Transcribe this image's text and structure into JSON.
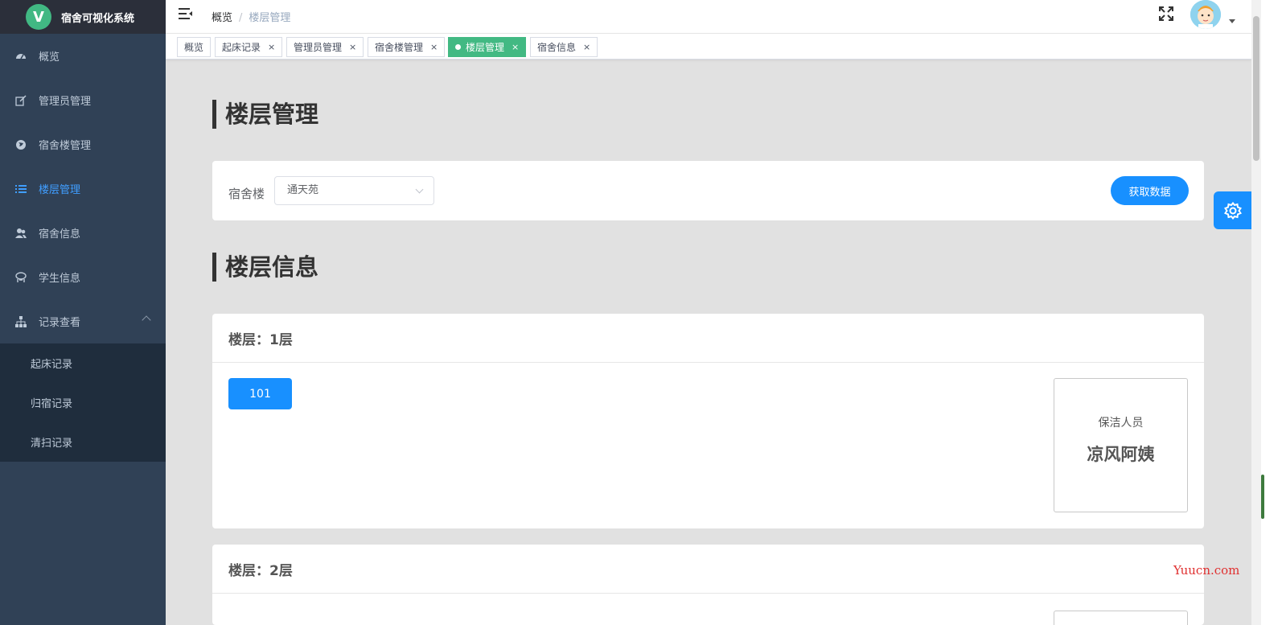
{
  "app": {
    "logo_letter": "V",
    "title": "宿舍可视化系统"
  },
  "sidebar": {
    "items": [
      {
        "label": "概览",
        "icon": "dashboard-icon"
      },
      {
        "label": "管理员管理",
        "icon": "edit-icon"
      },
      {
        "label": "宿舍楼管理",
        "icon": "globe-icon"
      },
      {
        "label": "楼层管理",
        "icon": "list-icon",
        "active": true
      },
      {
        "label": "宿舍信息",
        "icon": "users-icon"
      },
      {
        "label": "学生信息",
        "icon": "student-icon"
      },
      {
        "label": "记录查看",
        "icon": "sitemap-icon"
      }
    ],
    "submenu": [
      "起床记录",
      "归宿记录",
      "清扫记录"
    ]
  },
  "header": {
    "breadcrumb": [
      "概览",
      "楼层管理"
    ]
  },
  "tags": [
    {
      "label": "概览",
      "closable": false
    },
    {
      "label": "起床记录",
      "closable": true
    },
    {
      "label": "管理员管理",
      "closable": true
    },
    {
      "label": "宿舍楼管理",
      "closable": true
    },
    {
      "label": "楼层管理",
      "closable": true,
      "active": true
    },
    {
      "label": "宿舍信息",
      "closable": true
    }
  ],
  "tag_close": "×",
  "page": {
    "section1_title": "楼层管理",
    "filter_label": "宿舍楼",
    "select_value": "通天苑",
    "fetch_button": "获取数据",
    "section2_title": "楼层信息"
  },
  "floors": [
    {
      "title": "楼层：1层",
      "rooms": [
        "101"
      ],
      "cleaner_label": "保洁人员",
      "cleaner_name": "凉风阿姨"
    },
    {
      "title": "楼层：2层"
    }
  ],
  "watermark": "Yuucn.com",
  "colors": {
    "sidebar_bg": "#304156",
    "active_menu": "#409eff",
    "tag_active": "#42b983",
    "primary": "#1890ff"
  }
}
